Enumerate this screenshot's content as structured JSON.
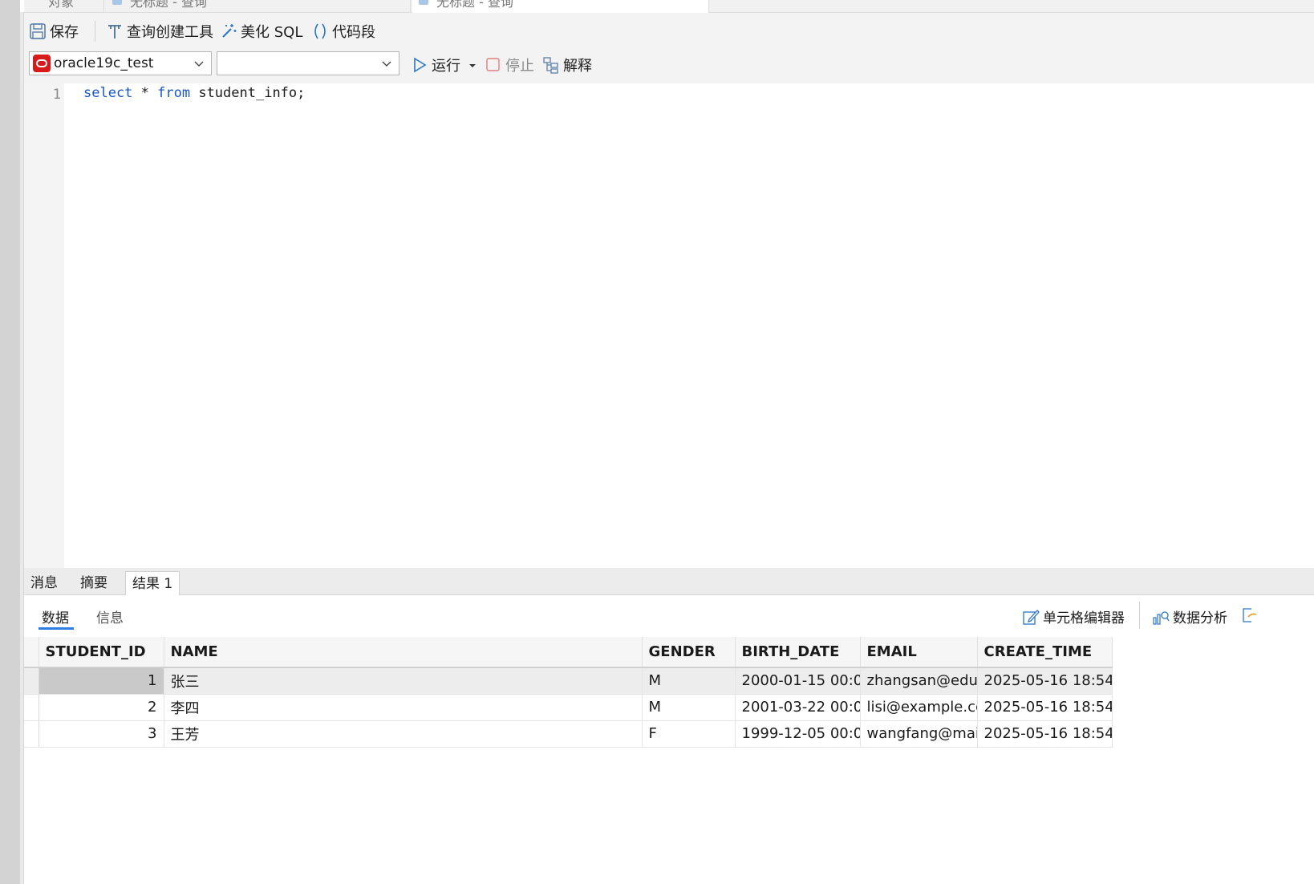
{
  "tabs": [
    {
      "label": "对象"
    },
    {
      "label": "无标题 - 查询"
    },
    {
      "label": "无标题 - 查询"
    }
  ],
  "toolbar": {
    "save_label": "保存",
    "query_builder_label": "查询创建工具",
    "beautify_label": "美化 SQL",
    "snippet_label": "代码段"
  },
  "connection": {
    "selected": "oracle19c_test",
    "schema_selected": ""
  },
  "run_bar": {
    "run_label": "运行",
    "stop_label": "停止",
    "explain_label": "解释"
  },
  "editor": {
    "line_number": "1",
    "kw_select": "select",
    "star": " * ",
    "kw_from": "from",
    "rest": " student_info;"
  },
  "panel_tabs": [
    {
      "label": "消息"
    },
    {
      "label": "摘要"
    },
    {
      "label": "结果 1"
    }
  ],
  "sub_tabs": [
    {
      "label": "数据"
    },
    {
      "label": "信息"
    }
  ],
  "right_tools": {
    "cell_editor_label": "单元格编辑器",
    "data_analysis_label": "数据分析"
  },
  "grid": {
    "columns": [
      "STUDENT_ID",
      "NAME",
      "GENDER",
      "BIRTH_DATE",
      "EMAIL",
      "CREATE_TIME"
    ],
    "rows": [
      [
        "1",
        "张三",
        "M",
        "2000-01-15 00:0",
        "zhangsan@edu",
        "2025-05-16 18:54"
      ],
      [
        "2",
        "李四",
        "M",
        "2001-03-22 00:0",
        "lisi@example.cc",
        "2025-05-16 18:54"
      ],
      [
        "3",
        "王芳",
        "F",
        "1999-12-05 00:0",
        "wangfang@mai",
        "2025-05-16 18:54"
      ]
    ]
  },
  "colors": {
    "keyword": "#1a56c9",
    "accent": "#2f7ee6",
    "oracle_red": "#d71b1b"
  }
}
